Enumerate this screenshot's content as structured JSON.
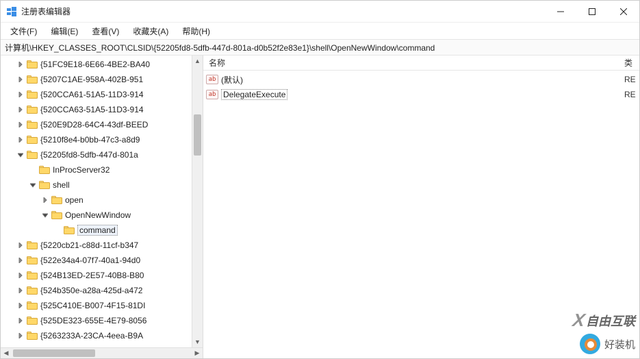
{
  "title": "注册表编辑器",
  "menu": {
    "file": "文件(F)",
    "edit": "编辑(E)",
    "view": "查看(V)",
    "favorites": "收藏夹(A)",
    "help": "帮助(H)"
  },
  "address": "计算机\\HKEY_CLASSES_ROOT\\CLSID\\{52205fd8-5dfb-447d-801a-d0b52f2e83e1}\\shell\\OpenNewWindow\\command",
  "tree": [
    {
      "indent": 1,
      "expand": "right",
      "label": "{51FC9E18-6E66-4BE2-BA40"
    },
    {
      "indent": 1,
      "expand": "right",
      "label": "{5207C1AE-958A-402B-951"
    },
    {
      "indent": 1,
      "expand": "right",
      "label": "{520CCA61-51A5-11D3-914"
    },
    {
      "indent": 1,
      "expand": "right",
      "label": "{520CCA63-51A5-11D3-914"
    },
    {
      "indent": 1,
      "expand": "right",
      "label": "{520E9D28-64C4-43df-BEED"
    },
    {
      "indent": 1,
      "expand": "right",
      "label": "{5210f8e4-b0bb-47c3-a8d9"
    },
    {
      "indent": 1,
      "expand": "down",
      "label": "{52205fd8-5dfb-447d-801a"
    },
    {
      "indent": 2,
      "expand": "none",
      "label": "InProcServer32"
    },
    {
      "indent": 2,
      "expand": "down",
      "label": "shell"
    },
    {
      "indent": 3,
      "expand": "right",
      "label": "open"
    },
    {
      "indent": 3,
      "expand": "down",
      "label": "OpenNewWindow"
    },
    {
      "indent": 4,
      "expand": "none",
      "label": "command",
      "selected": true
    },
    {
      "indent": 1,
      "expand": "right",
      "label": "{5220cb21-c88d-11cf-b347"
    },
    {
      "indent": 1,
      "expand": "right",
      "label": "{522e34a4-07f7-40a1-94d0"
    },
    {
      "indent": 1,
      "expand": "right",
      "label": "{524B13ED-2E57-40B8-B80"
    },
    {
      "indent": 1,
      "expand": "right",
      "label": "{524b350e-a28a-425d-a472"
    },
    {
      "indent": 1,
      "expand": "right",
      "label": "{525C410E-B007-4F15-81DI"
    },
    {
      "indent": 1,
      "expand": "right",
      "label": "{525DE323-655E-4E79-8056"
    },
    {
      "indent": 1,
      "expand": "right",
      "label": "{5263233A-23CA-4eea-B9A"
    }
  ],
  "columns": {
    "name": "名称",
    "type": "类"
  },
  "values": [
    {
      "name": "(默认)",
      "type": "RE",
      "selected": false
    },
    {
      "name": "DelegateExecute",
      "type": "RE",
      "selected": true
    }
  ],
  "watermark1": "自由互联",
  "watermark2": "好装机"
}
